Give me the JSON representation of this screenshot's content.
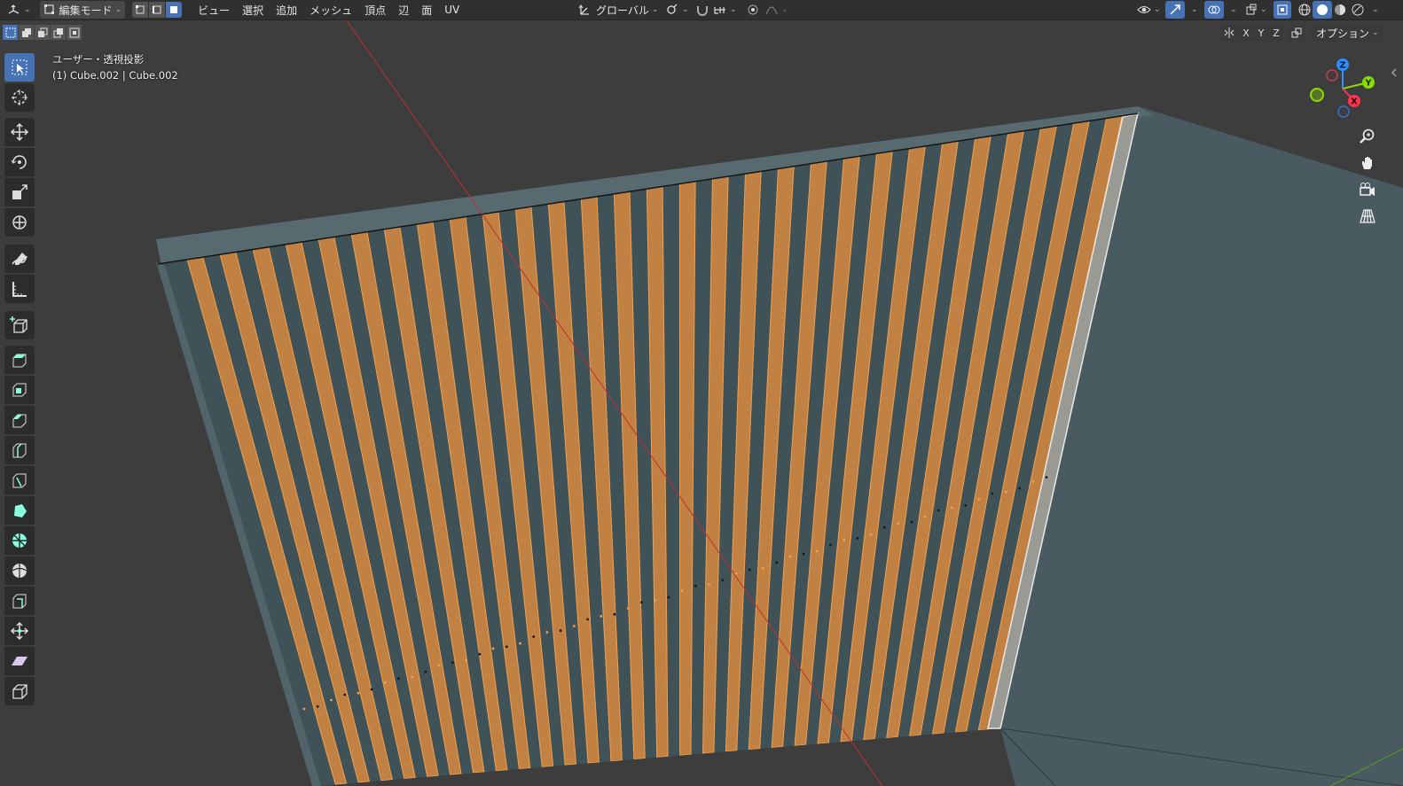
{
  "header": {
    "editor_icon": "view3d-icon",
    "mode": "編集モード",
    "menus": [
      "ビュー",
      "選択",
      "追加",
      "メッシュ",
      "頂点",
      "辺",
      "面",
      "UV"
    ],
    "transform_orientation": "グローバル",
    "pivot_icon": "pivot-icon",
    "snap_icon": "magnet-icon",
    "proportional_icon": "proportional-edit-icon"
  },
  "subheader": {
    "axis_labels": [
      "X",
      "Y",
      "Z"
    ],
    "options_label": "オプション"
  },
  "overlay_info": {
    "view_name": "ユーザー・透視投影",
    "object_name": "(1) Cube.002 | Cube.002"
  },
  "gizmo": {
    "x_label": "X",
    "y_label": "Y",
    "z_label": "Z",
    "x_color": "#ff3352",
    "y_color": "#8bdc00",
    "z_color": "#2890ff"
  },
  "toolbar": {
    "tools": [
      "select-box-icon",
      "cursor-icon",
      "move-icon",
      "rotate-icon",
      "scale-icon",
      "transform-icon",
      "annotate-icon",
      "measure-icon",
      "add-cube-icon",
      "extrude-icon",
      "inset-icon",
      "bevel-icon",
      "loop-cut-icon",
      "knife-icon",
      "poly-build-icon",
      "spin-icon",
      "smooth-icon",
      "edge-slide-icon",
      "shrink-fatten-icon",
      "shear-icon",
      "rip-icon"
    ]
  },
  "colors": {
    "background": "#3d3d3d",
    "mesh_face": "#46595f",
    "selected_face": "#d88a3f",
    "active_blue": "#4772b3"
  }
}
